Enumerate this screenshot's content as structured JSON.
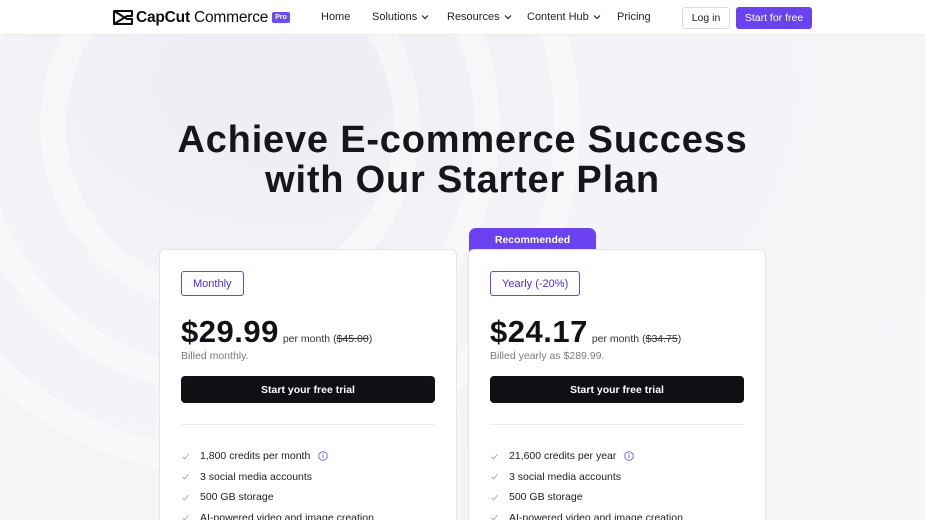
{
  "nav": {
    "logo_brand": "CapCut",
    "logo_product": "Commerce",
    "logo_badge": "Pro",
    "items": [
      {
        "label": "Home",
        "dropdown": false
      },
      {
        "label": "Solutions",
        "dropdown": true
      },
      {
        "label": "Resources",
        "dropdown": true
      },
      {
        "label": "Content Hub",
        "dropdown": true
      },
      {
        "label": "Pricing",
        "dropdown": false
      }
    ],
    "login_label": "Log in",
    "start_label": "Start for free"
  },
  "hero": {
    "title_line1": "Achieve E-commerce Success",
    "title_line2": "with Our Starter Plan"
  },
  "colors": {
    "accent": "#6a42f0",
    "dark_button": "#0f0f14",
    "background": "#f4f4f8"
  },
  "plans": [
    {
      "period": "Monthly",
      "price": "$29.99",
      "per": "per month",
      "original": "$45.00",
      "billed": "Billed monthly.",
      "cta": "Start your free trial",
      "features": [
        {
          "text": "1,800 credits per month",
          "info": true
        },
        {
          "text": "3 social media accounts",
          "info": false
        },
        {
          "text": "500 GB storage",
          "info": false
        },
        {
          "text": "AI-powered video and image creation",
          "info": false
        }
      ]
    },
    {
      "badge": "Recommended",
      "period": "Yearly (-20%)",
      "price": "$24.17",
      "per": "per month",
      "original": "$34.75",
      "billed": "Billed yearly as $289.99.",
      "cta": "Start your free trial",
      "features": [
        {
          "text": "21,600 credits per year",
          "info": true
        },
        {
          "text": "3 social media accounts",
          "info": false
        },
        {
          "text": "500 GB storage",
          "info": false
        },
        {
          "text": "AI-powered video and image creation",
          "info": false
        }
      ]
    }
  ]
}
